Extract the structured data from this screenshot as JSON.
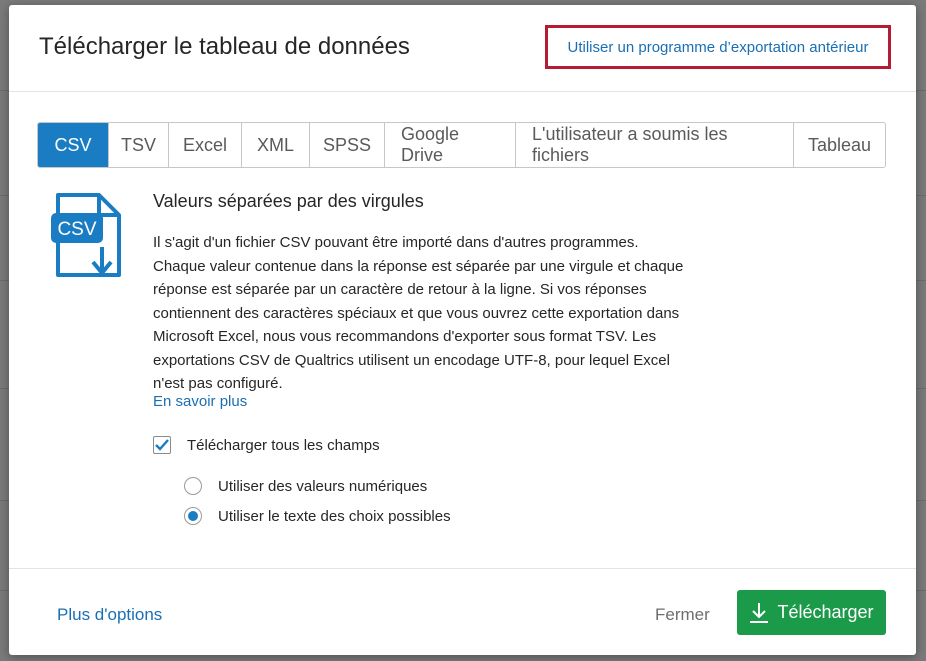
{
  "dialog": {
    "title": "Télécharger le tableau de données",
    "legacy_link": "Utiliser un programme d’exportation antérieur"
  },
  "tabs": [
    {
      "label": "CSV",
      "active": true
    },
    {
      "label": "TSV",
      "active": false
    },
    {
      "label": "Excel",
      "active": false
    },
    {
      "label": "XML",
      "active": false
    },
    {
      "label": "SPSS",
      "active": false
    },
    {
      "label": "Google Drive",
      "active": false
    },
    {
      "label": "L'utilisateur a soumis les fichiers",
      "active": false
    },
    {
      "label": "Tableau",
      "active": false
    }
  ],
  "format": {
    "icon": "csv-file-download-icon",
    "icon_label": "CSV",
    "title": "Valeurs séparées par des virgules",
    "description": "Il s'agit d'un fichier CSV pouvant être importé dans d'autres programmes. Chaque valeur contenue dans la réponse est séparée par une virgule et chaque réponse est séparée par un caractère de retour à la ligne. Si vos réponses contiennent des caractères spéciaux et que vous ouvrez cette exportation dans Microsoft Excel, nous vous recommandons d'exporter sous format TSV. Les exportations CSV de Qualtrics utilisent un encodage UTF-8, pour lequel Excel n'est pas configuré.",
    "learn_more": "En savoir plus"
  },
  "options": {
    "download_all_fields": {
      "label": "Télécharger tous les champs",
      "checked": true
    },
    "radios": [
      {
        "label": "Utiliser des valeurs numériques",
        "selected": false
      },
      {
        "label": "Utiliser le texte des choix possibles",
        "selected": true
      }
    ]
  },
  "footer": {
    "more_options": "Plus d'options",
    "close": "Fermer",
    "download": "Télécharger"
  },
  "colors": {
    "accent": "#1a7dc4",
    "link": "#1a6fb4",
    "primary_button": "#1b9a4a",
    "highlight_border": "#b51c34"
  }
}
